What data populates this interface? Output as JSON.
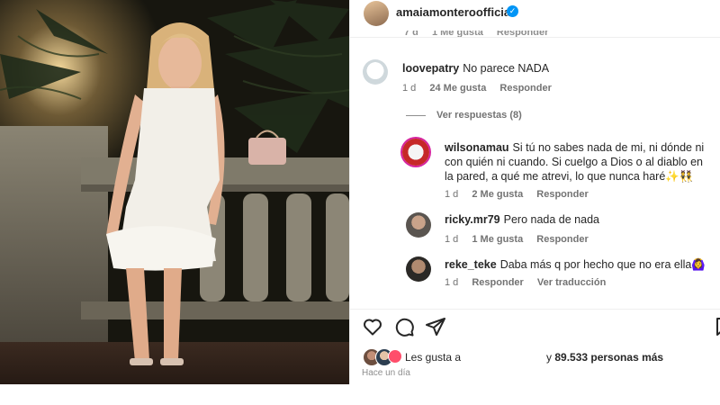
{
  "post": {
    "author": "amaiamonteroofficial",
    "verified_icon": "verified-badge-icon",
    "clipped_meta": [
      "7 d",
      "1 Me gusta",
      "Responder"
    ]
  },
  "comments": [
    {
      "user": "loovepatry",
      "text": "No parece NADA",
      "meta": {
        "age": "1 d",
        "likes": "24 Me gusta",
        "reply": "Responder"
      }
    },
    {
      "user": "wilsonamau",
      "text": "Si tú no sabes nada de mi, ni dónde ni con quién ni cuando. Si cuelgo a Dios o al diablo en la pared, a qué me atrevi, lo que nunca haré✨👯",
      "meta": {
        "age": "1 d",
        "likes": "2 Me gusta",
        "reply": "Responder"
      }
    },
    {
      "user": "ricky.mr79",
      "text": "Pero nada de nada",
      "meta": {
        "age": "1 d",
        "likes": "1 Me gusta",
        "reply": "Responder"
      }
    },
    {
      "user": "reke_teke",
      "text": "Daba más q por hecho que no era ella🙆‍♀️",
      "meta": {
        "age": "1 d",
        "reply": "Responder",
        "translate": "Ver traducción"
      }
    }
  ],
  "view_replies": "Ver respuestas (8)",
  "actions": {
    "like_icon": "heart-icon",
    "comment_icon": "comment-icon",
    "share_icon": "share-icon",
    "save_icon": "bookmark-icon"
  },
  "likes": {
    "prefix": "Les gusta a",
    "suffix_pre": "y",
    "count": "89.533 personas más"
  },
  "timestamp": "Hace un día"
}
